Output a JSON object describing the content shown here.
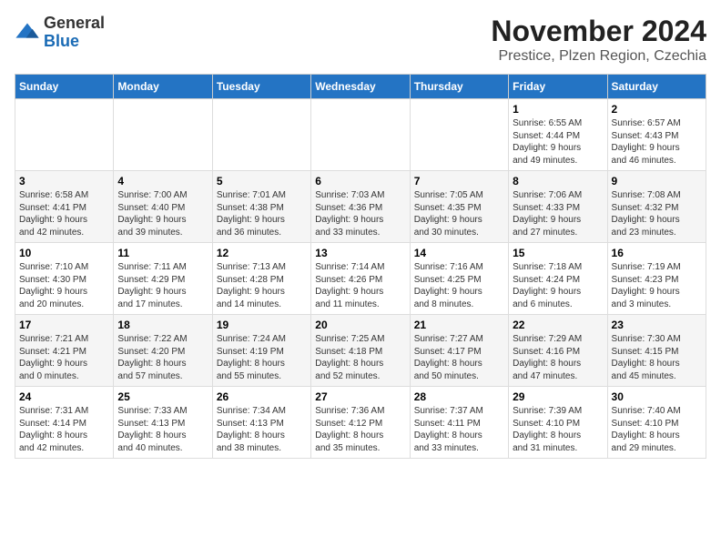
{
  "logo": {
    "general": "General",
    "blue": "Blue"
  },
  "header": {
    "month": "November 2024",
    "location": "Prestice, Plzen Region, Czechia"
  },
  "weekdays": [
    "Sunday",
    "Monday",
    "Tuesday",
    "Wednesday",
    "Thursday",
    "Friday",
    "Saturday"
  ],
  "weeks": [
    [
      {
        "day": "",
        "info": ""
      },
      {
        "day": "",
        "info": ""
      },
      {
        "day": "",
        "info": ""
      },
      {
        "day": "",
        "info": ""
      },
      {
        "day": "",
        "info": ""
      },
      {
        "day": "1",
        "info": "Sunrise: 6:55 AM\nSunset: 4:44 PM\nDaylight: 9 hours\nand 49 minutes."
      },
      {
        "day": "2",
        "info": "Sunrise: 6:57 AM\nSunset: 4:43 PM\nDaylight: 9 hours\nand 46 minutes."
      }
    ],
    [
      {
        "day": "3",
        "info": "Sunrise: 6:58 AM\nSunset: 4:41 PM\nDaylight: 9 hours\nand 42 minutes."
      },
      {
        "day": "4",
        "info": "Sunrise: 7:00 AM\nSunset: 4:40 PM\nDaylight: 9 hours\nand 39 minutes."
      },
      {
        "day": "5",
        "info": "Sunrise: 7:01 AM\nSunset: 4:38 PM\nDaylight: 9 hours\nand 36 minutes."
      },
      {
        "day": "6",
        "info": "Sunrise: 7:03 AM\nSunset: 4:36 PM\nDaylight: 9 hours\nand 33 minutes."
      },
      {
        "day": "7",
        "info": "Sunrise: 7:05 AM\nSunset: 4:35 PM\nDaylight: 9 hours\nand 30 minutes."
      },
      {
        "day": "8",
        "info": "Sunrise: 7:06 AM\nSunset: 4:33 PM\nDaylight: 9 hours\nand 27 minutes."
      },
      {
        "day": "9",
        "info": "Sunrise: 7:08 AM\nSunset: 4:32 PM\nDaylight: 9 hours\nand 23 minutes."
      }
    ],
    [
      {
        "day": "10",
        "info": "Sunrise: 7:10 AM\nSunset: 4:30 PM\nDaylight: 9 hours\nand 20 minutes."
      },
      {
        "day": "11",
        "info": "Sunrise: 7:11 AM\nSunset: 4:29 PM\nDaylight: 9 hours\nand 17 minutes."
      },
      {
        "day": "12",
        "info": "Sunrise: 7:13 AM\nSunset: 4:28 PM\nDaylight: 9 hours\nand 14 minutes."
      },
      {
        "day": "13",
        "info": "Sunrise: 7:14 AM\nSunset: 4:26 PM\nDaylight: 9 hours\nand 11 minutes."
      },
      {
        "day": "14",
        "info": "Sunrise: 7:16 AM\nSunset: 4:25 PM\nDaylight: 9 hours\nand 8 minutes."
      },
      {
        "day": "15",
        "info": "Sunrise: 7:18 AM\nSunset: 4:24 PM\nDaylight: 9 hours\nand 6 minutes."
      },
      {
        "day": "16",
        "info": "Sunrise: 7:19 AM\nSunset: 4:23 PM\nDaylight: 9 hours\nand 3 minutes."
      }
    ],
    [
      {
        "day": "17",
        "info": "Sunrise: 7:21 AM\nSunset: 4:21 PM\nDaylight: 9 hours\nand 0 minutes."
      },
      {
        "day": "18",
        "info": "Sunrise: 7:22 AM\nSunset: 4:20 PM\nDaylight: 8 hours\nand 57 minutes."
      },
      {
        "day": "19",
        "info": "Sunrise: 7:24 AM\nSunset: 4:19 PM\nDaylight: 8 hours\nand 55 minutes."
      },
      {
        "day": "20",
        "info": "Sunrise: 7:25 AM\nSunset: 4:18 PM\nDaylight: 8 hours\nand 52 minutes."
      },
      {
        "day": "21",
        "info": "Sunrise: 7:27 AM\nSunset: 4:17 PM\nDaylight: 8 hours\nand 50 minutes."
      },
      {
        "day": "22",
        "info": "Sunrise: 7:29 AM\nSunset: 4:16 PM\nDaylight: 8 hours\nand 47 minutes."
      },
      {
        "day": "23",
        "info": "Sunrise: 7:30 AM\nSunset: 4:15 PM\nDaylight: 8 hours\nand 45 minutes."
      }
    ],
    [
      {
        "day": "24",
        "info": "Sunrise: 7:31 AM\nSunset: 4:14 PM\nDaylight: 8 hours\nand 42 minutes."
      },
      {
        "day": "25",
        "info": "Sunrise: 7:33 AM\nSunset: 4:13 PM\nDaylight: 8 hours\nand 40 minutes."
      },
      {
        "day": "26",
        "info": "Sunrise: 7:34 AM\nSunset: 4:13 PM\nDaylight: 8 hours\nand 38 minutes."
      },
      {
        "day": "27",
        "info": "Sunrise: 7:36 AM\nSunset: 4:12 PM\nDaylight: 8 hours\nand 35 minutes."
      },
      {
        "day": "28",
        "info": "Sunrise: 7:37 AM\nSunset: 4:11 PM\nDaylight: 8 hours\nand 33 minutes."
      },
      {
        "day": "29",
        "info": "Sunrise: 7:39 AM\nSunset: 4:10 PM\nDaylight: 8 hours\nand 31 minutes."
      },
      {
        "day": "30",
        "info": "Sunrise: 7:40 AM\nSunset: 4:10 PM\nDaylight: 8 hours\nand 29 minutes."
      }
    ]
  ]
}
